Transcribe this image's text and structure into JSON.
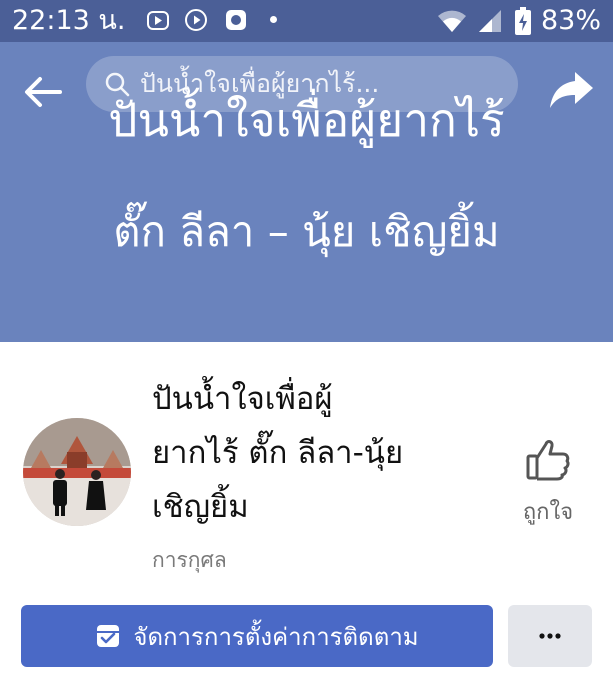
{
  "status_bar": {
    "time": "22:13 น.",
    "battery": "83%",
    "icons": [
      "youtube-music-icon",
      "play-icon",
      "square-app-icon",
      "wifi-icon",
      "signal-icon",
      "battery-icon"
    ]
  },
  "cover": {
    "line1": "ปันน้ำใจเพื่อผู้ยากไร้",
    "line2": "ตั๊ก ลีลา – นุ้ย เชิญยิ้ม"
  },
  "header": {
    "search_text": "ปันน้ำใจเพื่อผู้ยากไร้...",
    "back_icon": "arrow-left-icon",
    "share_icon": "share-arrow-icon"
  },
  "page": {
    "name_lines": [
      "ปันน้ำใจเพื่อผู้",
      "ยากไร้ ตั๊ก ลีลา-นุ้ย",
      "เชิญยิ้ม"
    ],
    "category": "การกุศล",
    "like_label": "ถูกใจ"
  },
  "actions": {
    "follow_label": "จัดการการตั้งค่าการติดตาม",
    "more_label": "..."
  },
  "colors": {
    "status_bar": "#4b5f97",
    "cover": "#6a83bd",
    "primary_button": "#4a69c6",
    "secondary_button": "#e4e6eb"
  }
}
